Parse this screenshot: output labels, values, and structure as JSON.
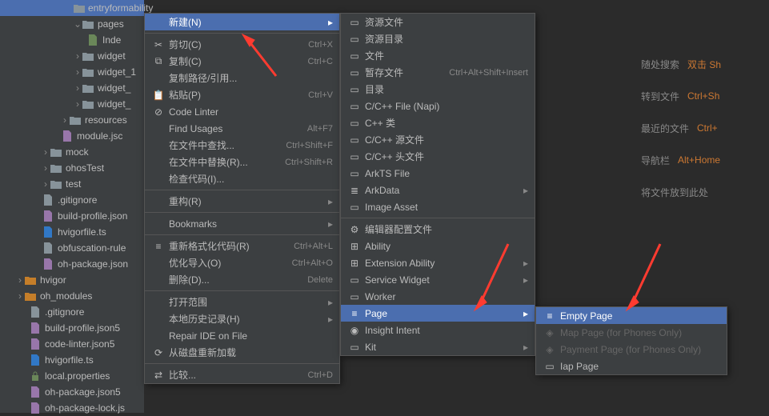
{
  "tree": {
    "entryformability": "entryformability",
    "pages": "pages",
    "inde": "Inde",
    "widget1": "widget",
    "widget2": "widget_1",
    "widget3": "widget_",
    "widget4": "widget_",
    "resources": "resources",
    "modulejs": "module.jsc",
    "mock": "mock",
    "ohostest": "ohosTest",
    "test": "test",
    "gitignore": ".gitignore",
    "buildprofile1": "build-profile.json",
    "hvigorfile1": "hvigorfile.ts",
    "obfuscation": "obfuscation-rule",
    "ohpkg1": "oh-package.json",
    "hvigor": "hvigor",
    "ohmodules": "oh_modules",
    "gitignore2": ".gitignore",
    "buildprofile2": "build-profile.json5",
    "codelinter": "code-linter.json5",
    "hvigorfile2": "hvigorfile.ts",
    "localprops": "local.properties",
    "ohpkg2": "oh-package.json5",
    "ohpkglock": "oh-package-lock.js"
  },
  "menu1": {
    "new": "新建(N)",
    "cut": "剪切(C)",
    "cut_sc": "Ctrl+X",
    "copy": "复制(C)",
    "copy_sc": "Ctrl+C",
    "copypath": "复制路径/引用...",
    "paste": "粘贴(P)",
    "paste_sc": "Ctrl+V",
    "codelinter": "Code Linter",
    "findusages": "Find Usages",
    "findusages_sc": "Alt+F7",
    "findinfiles": "在文件中查找...",
    "findinfiles_sc": "Ctrl+Shift+F",
    "replaceinfiles": "在文件中替换(R)...",
    "replaceinfiles_sc": "Ctrl+Shift+R",
    "inspect": "检查代码(I)...",
    "refactor": "重构(R)",
    "bookmarks": "Bookmarks",
    "reformat": "重新格式化代码(R)",
    "reformat_sc": "Ctrl+Alt+L",
    "optimize": "优化导入(O)",
    "optimize_sc": "Ctrl+Alt+O",
    "delete": "删除(D)...",
    "delete_sc": "Delete",
    "openin": "打开范围",
    "localhist": "本地历史记录(H)",
    "repairide": "Repair IDE on File",
    "reloaddisk": "从磁盘重新加载",
    "compare": "比较...",
    "compare_sc": "Ctrl+D"
  },
  "menu2": {
    "resfile": "资源文件",
    "resdir": "资源目录",
    "file": "文件",
    "scratch": "暂存文件",
    "scratch_sc": "Ctrl+Alt+Shift+Insert",
    "dir": "目录",
    "ccppfile": "C/C++ File (Napi)",
    "cppclass": "C++ 类",
    "ccppsrc": "C/C++ 源文件",
    "ccpphead": "C/C++ 头文件",
    "arkts": "ArkTS File",
    "arkdata": "ArkData",
    "imageasset": "Image Asset",
    "editorconfig": "编辑器配置文件",
    "ability": "Ability",
    "extability": "Extension Ability",
    "servicewidget": "Service Widget",
    "worker": "Worker",
    "page": "Page",
    "insight": "Insight Intent",
    "kit": "Kit"
  },
  "menu3": {
    "emptypage": "Empty Page",
    "mappage": "Map Page (for Phones Only)",
    "paymentpage": "Payment Page (for Phones Only)",
    "iappage": "Iap Page"
  },
  "hints": {
    "search": "随处搜索",
    "search_key": "双击 Sh",
    "gotofile": "转到文件",
    "gotofile_key": "Ctrl+Sh",
    "recent": "最近的文件",
    "recent_key": "Ctrl+",
    "navbar": "导航栏",
    "navbar_key": "Alt+Home",
    "drop": "将文件放到此处"
  }
}
